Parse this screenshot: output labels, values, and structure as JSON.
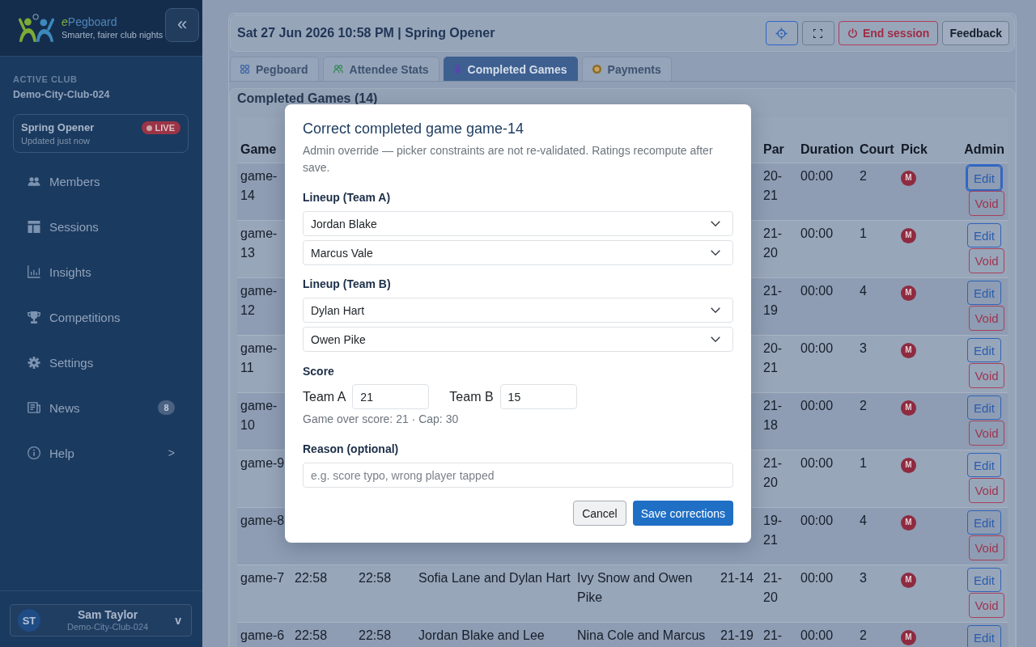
{
  "sidebar": {
    "brand": {
      "prefix": "e",
      "name": "Pegboard"
    },
    "tagline": "Smarter, fairer club nights",
    "collapse": "«",
    "active_club_label": "ACTIVE CLUB",
    "active_club": "Demo-City-Club-024",
    "session": {
      "name": "Spring Opener",
      "updated": "Updated just now",
      "status": "LIVE"
    },
    "items": [
      {
        "label": "Members"
      },
      {
        "label": "Sessions"
      },
      {
        "label": "Insights"
      },
      {
        "label": "Competitions"
      },
      {
        "label": "Settings"
      },
      {
        "label": "News",
        "badge": "8"
      },
      {
        "label": "Help",
        "chevron": ">"
      }
    ],
    "user": {
      "initials": "ST",
      "name": "Sam Taylor",
      "club": "Demo-City-Club-024",
      "caret": "v"
    }
  },
  "header": {
    "title": "Sat 27 Jun 2026 10:58 PM | Spring Opener",
    "buttons": [
      {
        "kind": "primary_icon"
      },
      {
        "kind": "icon"
      },
      {
        "kind": "danger",
        "label": "End session"
      },
      {
        "kind": "secondary",
        "label": "Feedback"
      }
    ]
  },
  "tabs": [
    {
      "label": "Pegboard",
      "selected": false
    },
    {
      "label": "Attendee Stats",
      "selected": false
    },
    {
      "label": "Completed Games",
      "selected": true
    },
    {
      "label": "Payments",
      "selected": false
    }
  ],
  "panel": {
    "title": "Completed Games (14)"
  },
  "table": {
    "columns": {
      "game": "Game",
      "par": "Par",
      "duration": "Duration",
      "court": "Court",
      "pick": "Pick",
      "admin": "Admin"
    },
    "rows": [
      {
        "game": "game-14",
        "par": "20-21",
        "duration": "00:00",
        "court": "2",
        "pick": "M",
        "edit": {
          "label": "Edit",
          "focused": true
        },
        "void": "Void"
      },
      {
        "game": "game-13",
        "par": "21-20",
        "duration": "00:00",
        "court": "1",
        "pick": "M",
        "edit": {
          "label": "Edit",
          "focused": false
        },
        "void": "Void"
      },
      {
        "game": "game-12",
        "par": "21-19",
        "duration": "00:00",
        "court": "4",
        "pick": "M",
        "edit": {
          "label": "Edit",
          "focused": false
        },
        "void": "Void"
      },
      {
        "game": "game-11",
        "par": "20-21",
        "duration": "00:00",
        "court": "3",
        "pick": "M",
        "edit": {
          "label": "Edit",
          "focused": false
        },
        "void": "Void"
      },
      {
        "game": "game-10",
        "par": "21-18",
        "duration": "00:00",
        "court": "2",
        "pick": "M",
        "edit": {
          "label": "Edit",
          "focused": false
        },
        "void": "Void"
      },
      {
        "game": "game-9",
        "par": "21-20",
        "duration": "00:00",
        "court": "1",
        "pick": "M",
        "edit": {
          "label": "Edit",
          "focused": false
        },
        "void": "Void"
      },
      {
        "game": "game-8",
        "par": "19-21",
        "duration": "00:00",
        "court": "4",
        "pick": "M",
        "edit": {
          "label": "Edit",
          "focused": false
        },
        "void": "Void"
      },
      {
        "game": "game-7",
        "column_2": "22:58",
        "column_3": "22:58",
        "column_4": "Sofia Lane and Dylan Hart",
        "column_5": "Ivy Snow and Owen Pike",
        "column_6": "21-14",
        "par": "21-20",
        "duration": "00:00",
        "court": "3",
        "pick": "M",
        "edit": {
          "label": "Edit",
          "focused": false
        },
        "void": "Void"
      },
      {
        "game": "game-6",
        "column_2": "22:58",
        "column_3": "22:58",
        "column_4": "Jordan Blake and Lee",
        "column_5": "Nina Cole and Marcus",
        "column_6": "21-19",
        "par": "21-",
        "duration": "00:00",
        "court": "2",
        "pick": "M",
        "edit": {
          "label": "Edit",
          "focused": false
        }
      }
    ]
  },
  "modal": {
    "title": "Correct completed game game-14",
    "description": "Admin override — picker constraints are not re-validated. Ratings recompute after save.",
    "lineups": [
      {
        "label": "Lineup (Team A)",
        "players": [
          "Jordan Blake",
          "Marcus Vale"
        ]
      },
      {
        "label": "Lineup (Team B)",
        "players": [
          "Dylan Hart",
          "Owen Pike"
        ]
      }
    ],
    "score": {
      "label": "Score",
      "team_a_label": "Team A",
      "team_a": "21",
      "team_b_label": "Team B",
      "team_b": "15",
      "hint": "Game over score: 21 · Cap: 30"
    },
    "reason": {
      "label": "Reason (optional)",
      "placeholder": "e.g. score typo, wrong player tapped"
    },
    "cancel": "Cancel",
    "save": "Save corrections"
  }
}
